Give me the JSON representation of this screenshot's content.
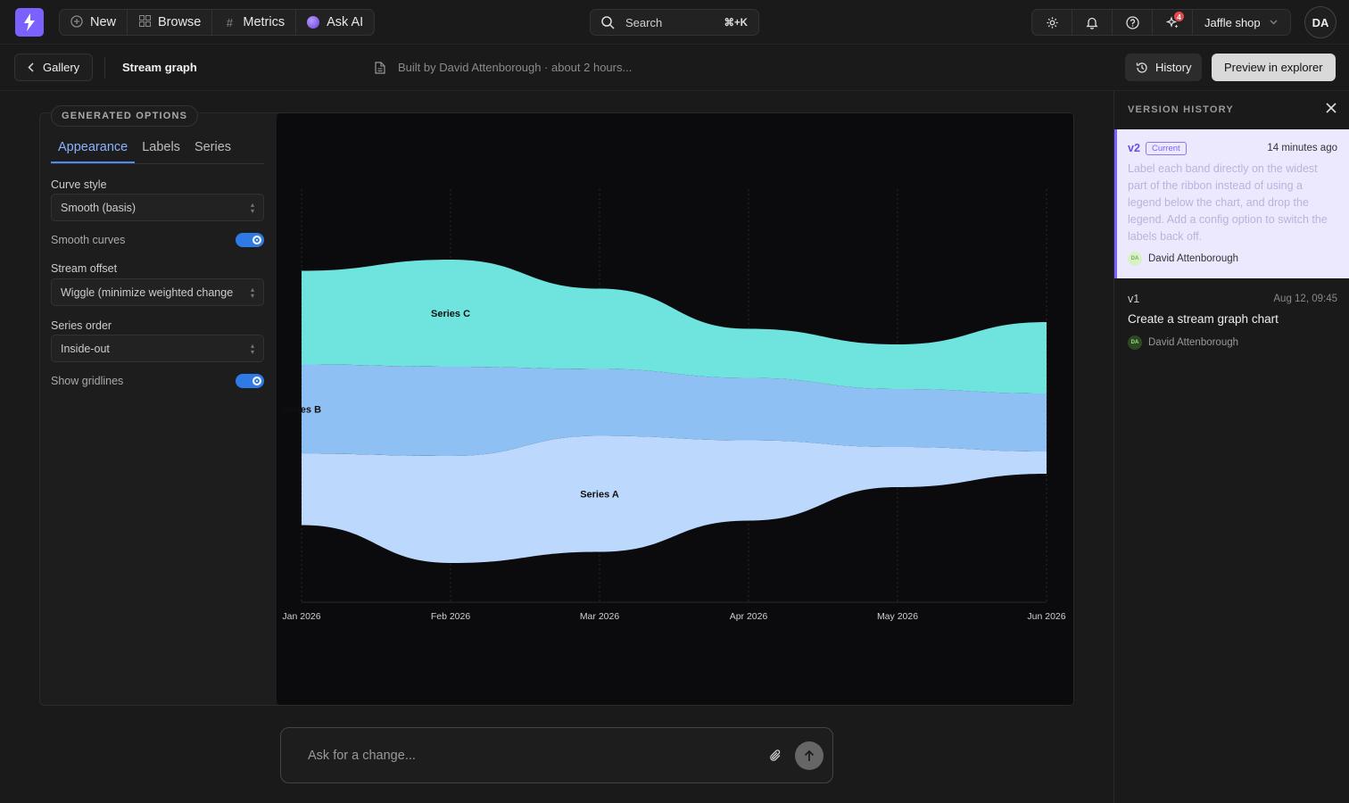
{
  "nav": {
    "new_label": "New",
    "browse_label": "Browse",
    "metrics_label": "Metrics",
    "ask_ai_label": "Ask AI",
    "search_placeholder": "Search",
    "search_shortcut": "⌘+K",
    "notifications_badge": "4",
    "workspace": "Jaffle shop",
    "user_initials": "DA"
  },
  "subheader": {
    "back_label": "Gallery",
    "title": "Stream graph",
    "built_by": "Built by David Attenborough · about 2 hours...",
    "history_label": "History",
    "preview_label": "Preview in explorer"
  },
  "options": {
    "section_label": "GENERATED OPTIONS",
    "tabs": [
      "Appearance",
      "Labels",
      "Series"
    ],
    "active_tab": "Appearance",
    "curve_style_label": "Curve style",
    "curve_style_value": "Smooth (basis)",
    "smooth_curves_label": "Smooth curves",
    "smooth_curves_on": true,
    "stream_offset_label": "Stream offset",
    "stream_offset_value": "Wiggle (minimize weighted change",
    "series_order_label": "Series order",
    "series_order_value": "Inside-out",
    "show_gridlines_label": "Show gridlines",
    "show_gridlines_on": true
  },
  "chart_data": {
    "type": "area",
    "subtype": "streamgraph",
    "x": [
      "Jan 2026",
      "Feb 2026",
      "Mar 2026",
      "Apr 2026",
      "May 2026",
      "Jun 2026"
    ],
    "series": [
      {
        "name": "Series A",
        "values": [
          16,
          24,
          26,
          18,
          9,
          5
        ],
        "color": "#bcd9fd"
      },
      {
        "name": "Series B",
        "values": [
          20,
          20,
          15,
          14,
          13,
          13
        ],
        "color": "#8fc0f3"
      },
      {
        "name": "Series C",
        "values": [
          21,
          24,
          18,
          11,
          10,
          16
        ],
        "color": "#6fe3dd"
      }
    ],
    "offset": "wiggle",
    "grid": true,
    "legend": "none",
    "direct_labels": true
  },
  "ask": {
    "placeholder": "Ask for a change..."
  },
  "history": {
    "title": "VERSION HISTORY",
    "versions": [
      {
        "version": "v2",
        "badge": "Current",
        "time": "14 minutes ago",
        "description": "Label each band directly on the widest part of the ribbon instead of using a legend below the chart, and drop the legend. Add a config option to switch the labels back off.",
        "author": "David Attenborough",
        "author_initials": "DA"
      },
      {
        "version": "v1",
        "time": "Aug 12, 09:45",
        "description": "Create a stream graph chart",
        "author": "David Attenborough",
        "author_initials": "DA"
      }
    ]
  }
}
